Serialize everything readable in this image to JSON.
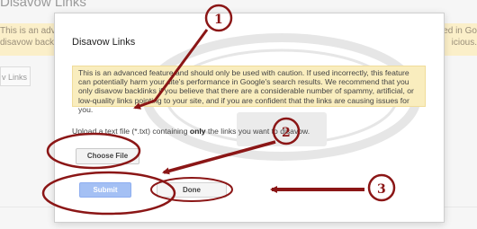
{
  "background": {
    "title": "Disavow Links",
    "banner_left_line1": "This is an advanced",
    "banner_left_line2": "disavow backli",
    "banner_right_line1": "ed in Go",
    "banner_right_line2": "icious.",
    "button_label": "v Links"
  },
  "dialog": {
    "title": "Disavow Links",
    "warning_text": "This is an advanced feature and should only be used with caution. If used incorrectly, this feature can potentially harm your site's performance in Google's search results. We recommend that you only disavow backlinks if you believe that there are a considerable number of spammy, artificial, or low-quality links pointing to your site, and if you are confident that the links are causing issues for you.",
    "upload_prefix": "Upload a text file (*.txt) containing ",
    "upload_bold": "only",
    "upload_suffix": " the links you want to disavow.",
    "choose_file_label": "Choose File",
    "submit_label": "Submit",
    "done_label": "Done"
  },
  "annotations": {
    "step1": "1",
    "step2": "2",
    "step3": "3",
    "color": "#8b1616"
  }
}
